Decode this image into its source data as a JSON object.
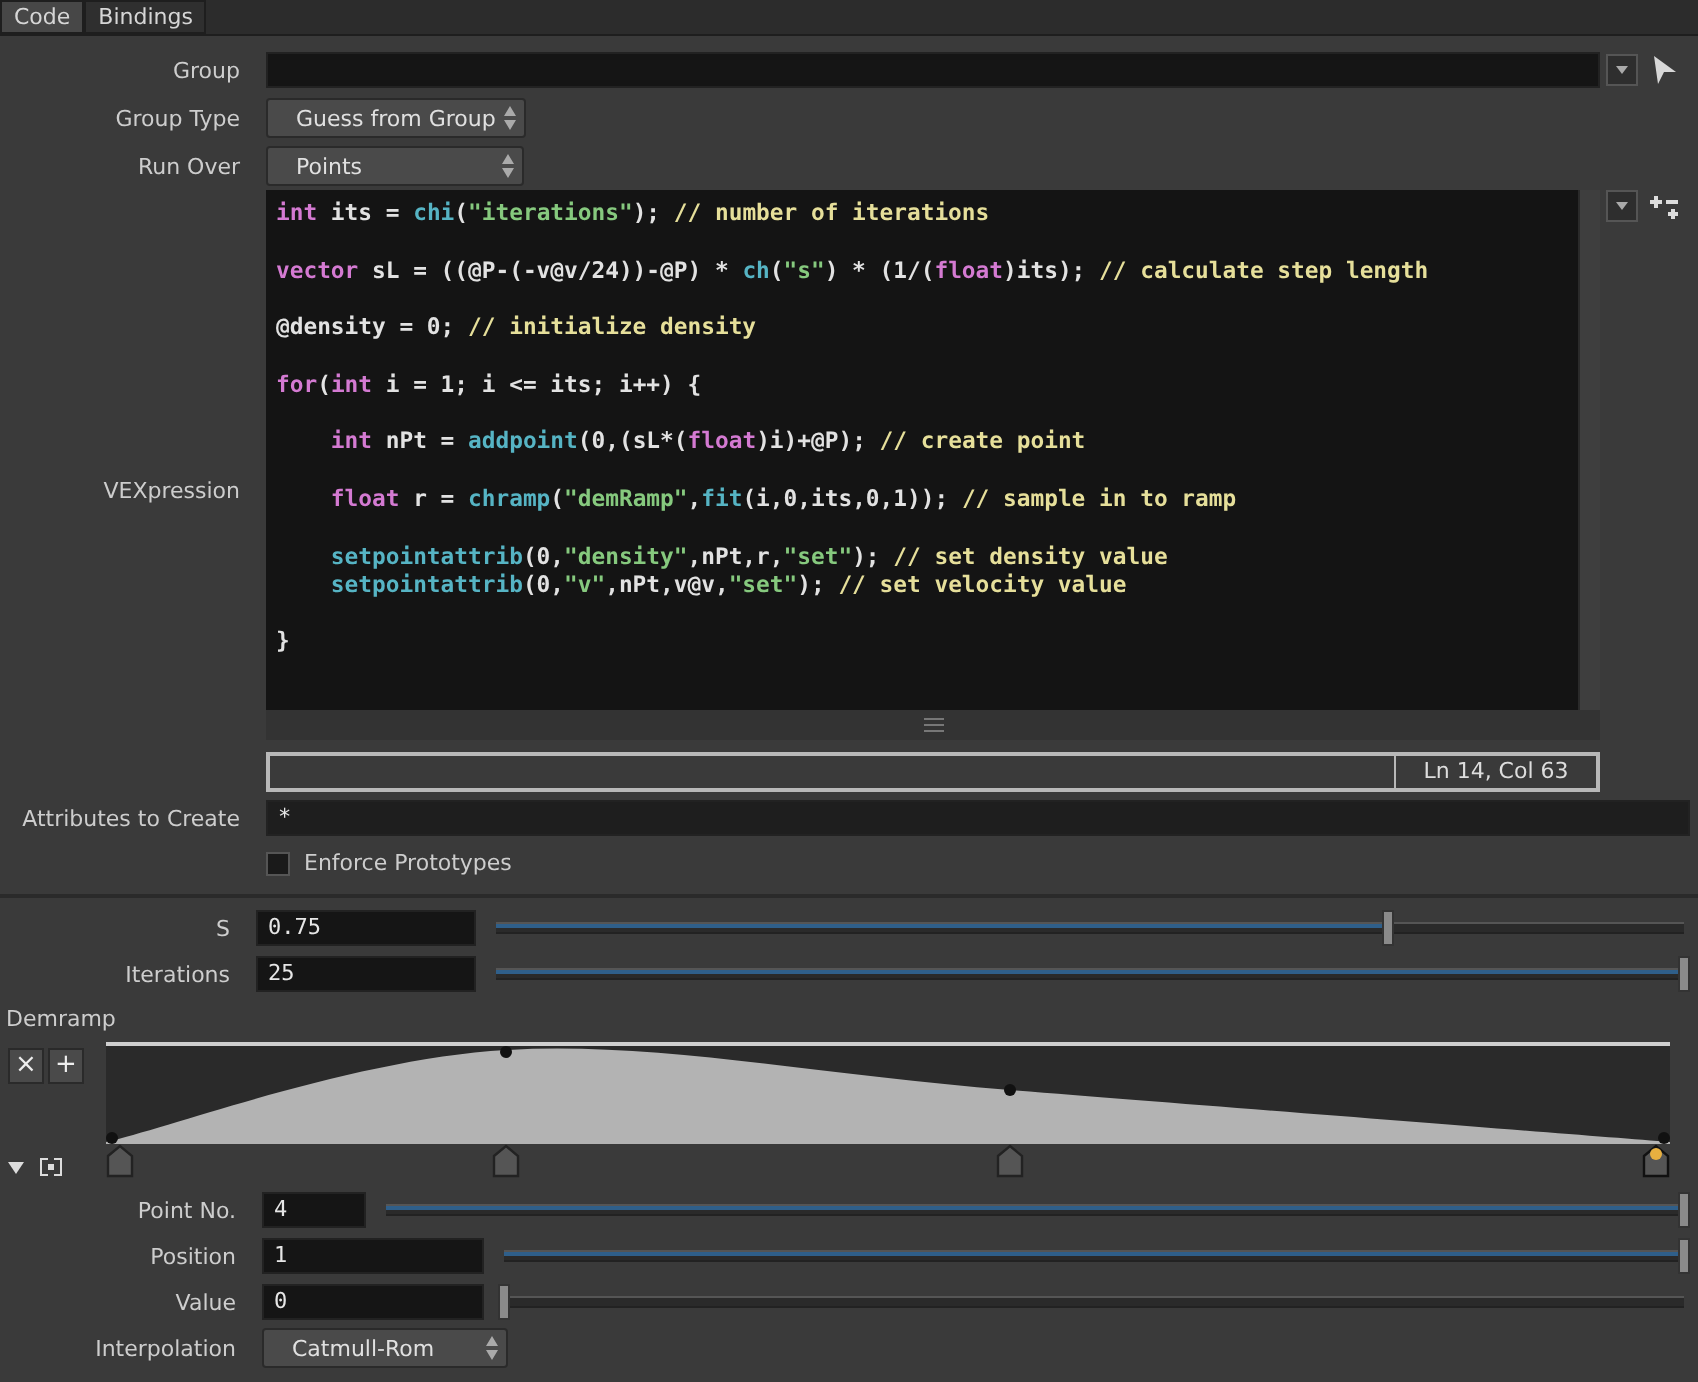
{
  "tabs": [
    {
      "label": "Code",
      "selected": true
    },
    {
      "label": "Bindings",
      "selected": false
    }
  ],
  "group": {
    "label": "Group"
  },
  "group_type": {
    "label": "Group Type",
    "value": "Guess from Group"
  },
  "run_over": {
    "label": "Run Over",
    "value": "Points"
  },
  "vexpression": {
    "label": "VEXpression",
    "status": "Ln 14, Col 63",
    "lines": [
      {
        "kind": "code",
        "indent": false,
        "tokens": [
          {
            "kind": "keyword",
            "text": "int"
          },
          {
            "kind": "plain",
            "text": " its = "
          },
          {
            "kind": "function",
            "text": "chi"
          },
          {
            "kind": "plain",
            "text": "("
          },
          {
            "kind": "string",
            "text": "\"iterations\""
          },
          {
            "kind": "plain",
            "text": "); "
          },
          {
            "kind": "comment",
            "text": "// number of iterations"
          }
        ]
      },
      {
        "kind": "blank"
      },
      {
        "kind": "code",
        "indent": false,
        "tokens": [
          {
            "kind": "keyword",
            "text": "vector"
          },
          {
            "kind": "plain",
            "text": " sL = ((@P-(-v@v/24))-@P) * "
          },
          {
            "kind": "function",
            "text": "ch"
          },
          {
            "kind": "plain",
            "text": "("
          },
          {
            "kind": "string",
            "text": "\"s\""
          },
          {
            "kind": "plain",
            "text": ") * (1/("
          },
          {
            "kind": "keyword",
            "text": "float"
          },
          {
            "kind": "plain",
            "text": ")its); "
          },
          {
            "kind": "comment",
            "text": "// calculate step length"
          }
        ]
      },
      {
        "kind": "blank"
      },
      {
        "kind": "code",
        "indent": false,
        "tokens": [
          {
            "kind": "plain",
            "text": "@density = 0; "
          },
          {
            "kind": "comment",
            "text": "// initialize density"
          }
        ]
      },
      {
        "kind": "blank"
      },
      {
        "kind": "code",
        "indent": false,
        "tokens": [
          {
            "kind": "keyword",
            "text": "for"
          },
          {
            "kind": "plain",
            "text": "("
          },
          {
            "kind": "keyword",
            "text": "int"
          },
          {
            "kind": "plain",
            "text": " i = 1; i <= its; i++) {"
          }
        ]
      },
      {
        "kind": "blank"
      },
      {
        "kind": "code",
        "indent": true,
        "tokens": [
          {
            "kind": "keyword",
            "text": "int"
          },
          {
            "kind": "plain",
            "text": " nPt = "
          },
          {
            "kind": "function",
            "text": "addpoint"
          },
          {
            "kind": "plain",
            "text": "(0,(sL*("
          },
          {
            "kind": "keyword",
            "text": "float"
          },
          {
            "kind": "plain",
            "text": ")i)+@P); "
          },
          {
            "kind": "comment",
            "text": "// create point"
          }
        ]
      },
      {
        "kind": "blank"
      },
      {
        "kind": "code",
        "indent": true,
        "tokens": [
          {
            "kind": "keyword",
            "text": "float"
          },
          {
            "kind": "plain",
            "text": " r = "
          },
          {
            "kind": "function",
            "text": "chramp"
          },
          {
            "kind": "plain",
            "text": "("
          },
          {
            "kind": "string",
            "text": "\"demRamp\""
          },
          {
            "kind": "plain",
            "text": ","
          },
          {
            "kind": "function",
            "text": "fit"
          },
          {
            "kind": "plain",
            "text": "(i,0,its,0,1)); "
          },
          {
            "kind": "comment",
            "text": "// sample in to ramp"
          }
        ]
      },
      {
        "kind": "blank"
      },
      {
        "kind": "code",
        "indent": true,
        "tokens": [
          {
            "kind": "function",
            "text": "setpointattrib"
          },
          {
            "kind": "plain",
            "text": "(0,"
          },
          {
            "kind": "string",
            "text": "\"density\""
          },
          {
            "kind": "plain",
            "text": ",nPt,r,"
          },
          {
            "kind": "string",
            "text": "\"set\""
          },
          {
            "kind": "plain",
            "text": "); "
          },
          {
            "kind": "comment",
            "text": "// set density value"
          }
        ]
      },
      {
        "kind": "code",
        "indent": true,
        "tokens": [
          {
            "kind": "function",
            "text": "setpointattrib"
          },
          {
            "kind": "plain",
            "text": "(0,"
          },
          {
            "kind": "string",
            "text": "\"v\""
          },
          {
            "kind": "plain",
            "text": ",nPt,v@v,"
          },
          {
            "kind": "string",
            "text": "\"set\""
          },
          {
            "kind": "plain",
            "text": "); "
          },
          {
            "kind": "comment",
            "text": "// set velocity value"
          }
        ]
      },
      {
        "kind": "blank"
      },
      {
        "kind": "code",
        "indent": false,
        "tokens": [
          {
            "kind": "plain",
            "text": "}"
          }
        ]
      }
    ]
  },
  "attributes_to_create": {
    "label": "Attributes to Create",
    "value": "*"
  },
  "enforce_prototypes": {
    "label": "Enforce Prototypes",
    "checked": false
  },
  "sliders": [
    {
      "label": "S",
      "value": "0.75",
      "level": 0.75
    },
    {
      "label": "Iterations",
      "value": "25",
      "level": 1
    }
  ],
  "ramp": {
    "label": "Demramp",
    "buttons": [
      "×",
      "+"
    ],
    "keys": [
      {
        "selected": false
      },
      {
        "selected": false
      },
      {
        "selected": false
      },
      {
        "selected": true
      }
    ],
    "key_fields": [
      {
        "kind": "index",
        "label": "Point No.",
        "value": "4",
        "level": 1
      },
      {
        "kind": "number",
        "label": "Position",
        "value": "1",
        "level": 1
      },
      {
        "kind": "number",
        "label": "Value",
        "value": "0",
        "level": 0
      }
    ],
    "interpolation": {
      "label": "Interpolation",
      "value": "Catmull-Rom"
    }
  }
}
